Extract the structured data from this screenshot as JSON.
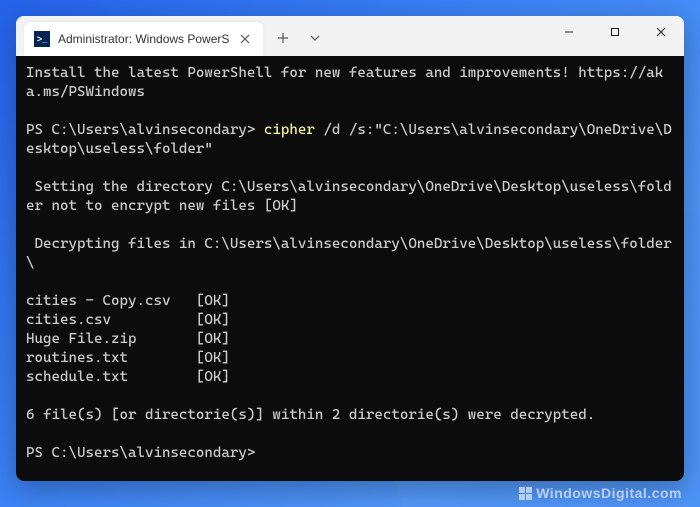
{
  "titlebar": {
    "tab_title": "Administrator: Windows PowerS",
    "tab_icon_glyph": ">_"
  },
  "terminal": {
    "banner": "Install the latest PowerShell for new features and improvements! https://aka.ms/PSWindows",
    "prompt1_prefix": "PS C:\\Users\\alvinsecondary> ",
    "prompt1_cmd": "cipher",
    "prompt1_args": " /d /s:\"C:\\Users\\alvinsecondary\\OneDrive\\Desktop\\useless\\folder\"",
    "msg_setdir": " Setting the directory C:\\Users\\alvinsecondary\\OneDrive\\Desktop\\useless\\folder not to encrypt new files [OK]",
    "msg_decrypt": " Decrypting files in C:\\Users\\alvinsecondary\\OneDrive\\Desktop\\useless\\folder\\",
    "files": [
      "cities - Copy.csv   [OK]",
      "cities.csv          [OK]",
      "Huge File.zip       [OK]",
      "routines.txt        [OK]",
      "schedule.txt        [OK]"
    ],
    "summary": "6 file(s) [or directorie(s)] within 2 directorie(s) were decrypted.",
    "prompt2": "PS C:\\Users\\alvinsecondary>"
  },
  "watermark": {
    "text": "WindowsDigital.com"
  }
}
